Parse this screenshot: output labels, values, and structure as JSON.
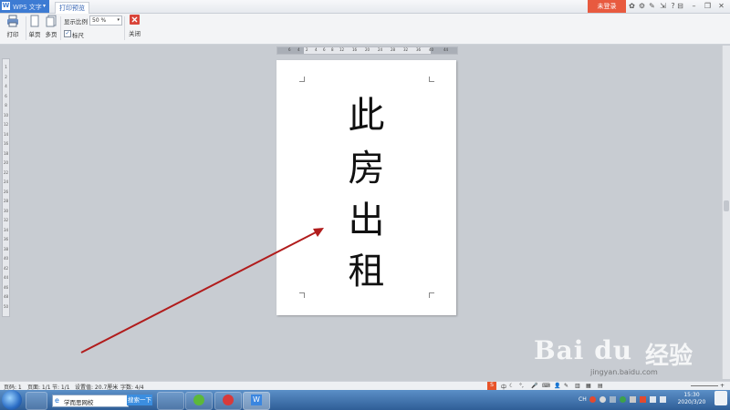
{
  "app": {
    "title": "WPS 文字",
    "logo": "W",
    "print_tab": "打印预览",
    "login": "未登录"
  },
  "ribbon": {
    "print": "打印",
    "single_page": "单页",
    "multi_page": "多页",
    "zoom_label": "显示比例",
    "zoom_value": "50 %",
    "ruler": "标尺",
    "close": "关闭"
  },
  "document": {
    "characters": [
      "此",
      "房",
      "出",
      "租"
    ]
  },
  "ruler": {
    "horizontal": [
      "6",
      "4",
      "2",
      "4",
      "6",
      "8",
      "12",
      "16",
      "20",
      "24",
      "28",
      "32",
      "36",
      "40",
      "44"
    ],
    "vertical": [
      "1",
      "2",
      "4",
      "6",
      "8",
      "10",
      "12",
      "14",
      "16",
      "18",
      "20",
      "22",
      "24",
      "26",
      "28",
      "30",
      "32",
      "34",
      "36",
      "38",
      "40",
      "42",
      "44",
      "46",
      "48",
      "50"
    ]
  },
  "statusbar": {
    "page": "页码: 1",
    "pages": "页面: 1/1",
    "section": "节: 1/1",
    "setting": "设置值: 20.7厘米",
    "words": "字数: 4/4"
  },
  "taskbar": {
    "search_text": "学而思网校",
    "search_button": "搜索一下",
    "time": "15:30",
    "date": "2020/3/20",
    "ime": "中",
    "lang": "CH"
  },
  "watermark": {
    "logo": "Bai du",
    "text": "经验",
    "url": "jingyan.baidu.com"
  },
  "colors": {
    "arrow": "#b11c1c",
    "accent": "#3d7bd3",
    "login": "#e85a3f",
    "close_icon": "#d9453a"
  }
}
